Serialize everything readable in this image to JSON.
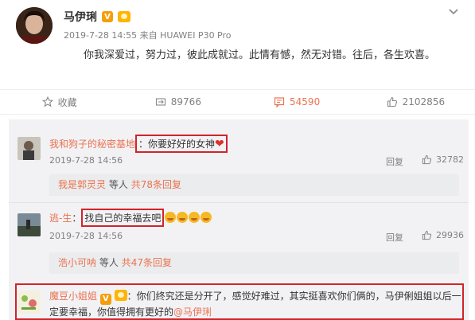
{
  "post": {
    "author": "马伊琍",
    "verified_badge": "V",
    "meta": "2019-7-28 14:55 来自 HUAWEI P30 Pro",
    "text": "你我深爱过，努力过，彼此成就过。此情有憾，然无对错。往后，各生欢喜。"
  },
  "actions": {
    "favorite": "收藏",
    "repost_count": "89766",
    "comment_count": "54590",
    "like_count": "2102856",
    "accent_color": "#eb7350"
  },
  "comments": [
    {
      "user": "我和狗子的秘密基地",
      "text": "你要好好的女神",
      "time": "2019-7-28 14:56",
      "reply": "回复",
      "likes": "32782",
      "sub_reply": {
        "user": "我是郭灵灵",
        "middle": "等人",
        "link": "共78条回复"
      }
    },
    {
      "user": "逃-生",
      "text": "找自己的幸福去吧",
      "time": "2019-7-28 14:56",
      "reply": "回复",
      "likes": "29936",
      "sub_reply": {
        "user": "浩小可呐",
        "middle": "等人",
        "link": "共47条回复"
      }
    },
    {
      "user": "魔豆小姐姐",
      "verified_badge": "V",
      "text_line1": "：你们终究还是分开了，感觉好难过，其实挺喜欢你们俩的，马伊俐姐姐以后一",
      "text_line2": "定要幸福，你值得拥有更好的",
      "mention": "@马伊琍"
    }
  ]
}
